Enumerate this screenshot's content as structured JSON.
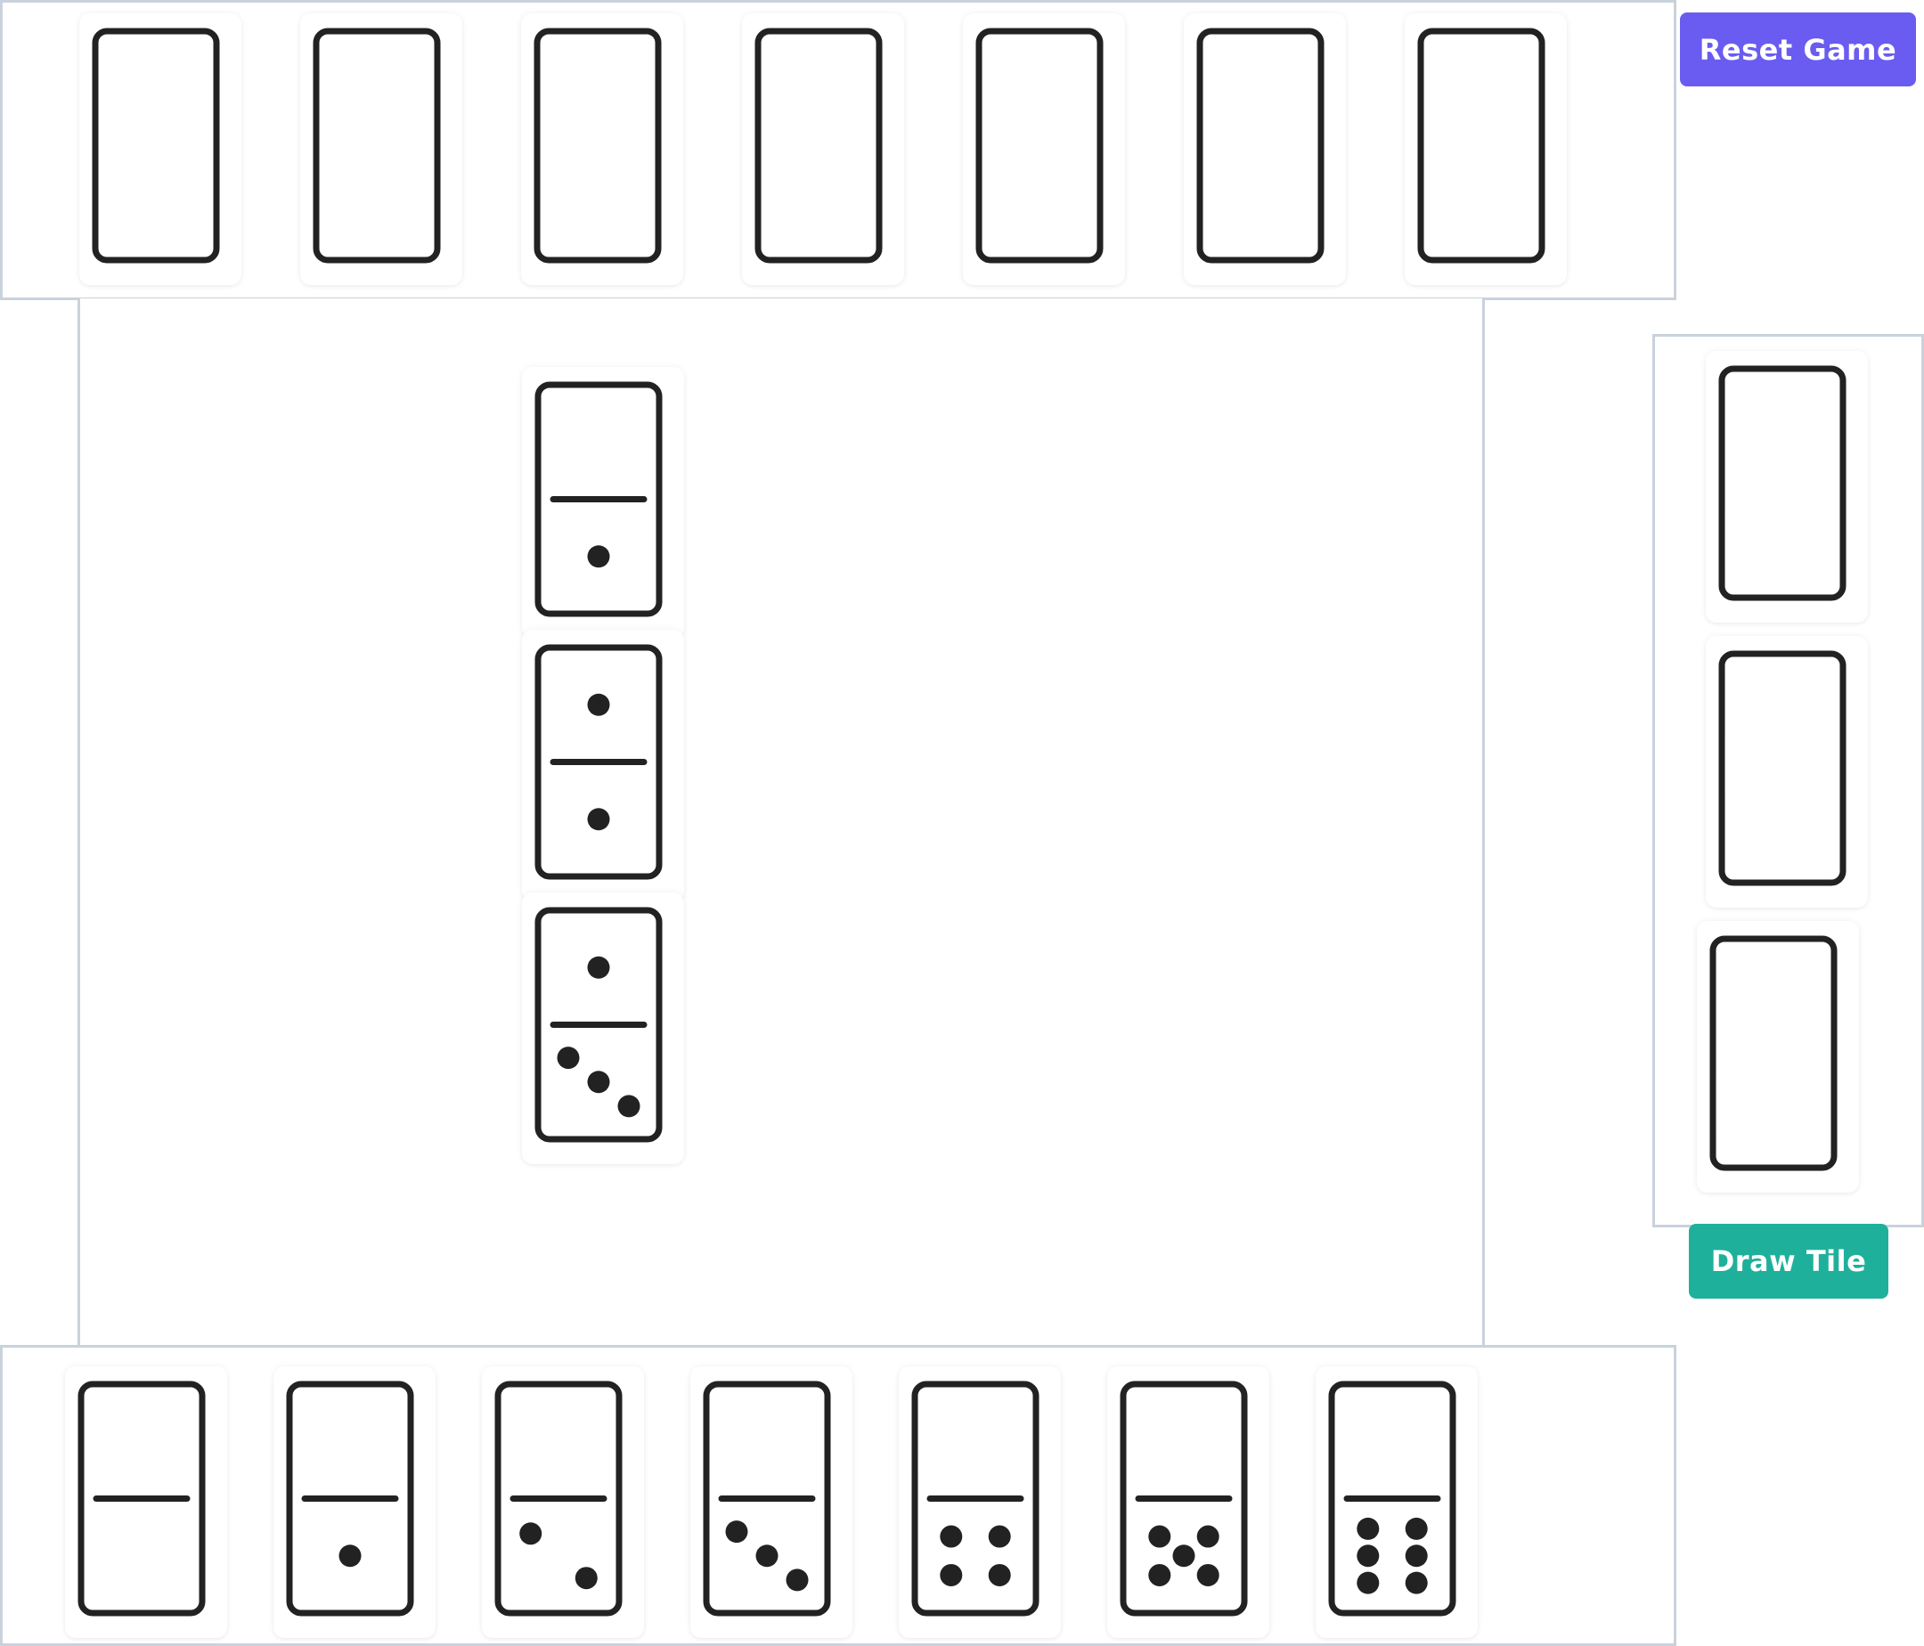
{
  "buttons": {
    "reset_label": "Reset Game",
    "draw_label": "Draw Tile"
  },
  "colors": {
    "reset_button": "#6a5cf0",
    "draw_button": "#1fb09c",
    "panel_border": "#c9d2dc",
    "tile_ink": "#222222"
  },
  "opponent_hand": {
    "face_down_count": 7
  },
  "board": {
    "chain": [
      [
        0,
        1
      ],
      [
        1,
        1
      ],
      [
        1,
        3
      ]
    ]
  },
  "boneyard": {
    "face_down_count": 3
  },
  "player_hand": {
    "tiles": [
      [
        0,
        0
      ],
      [
        0,
        1
      ],
      [
        0,
        2
      ],
      [
        0,
        3
      ],
      [
        0,
        4
      ],
      [
        0,
        5
      ],
      [
        0,
        6
      ]
    ]
  }
}
